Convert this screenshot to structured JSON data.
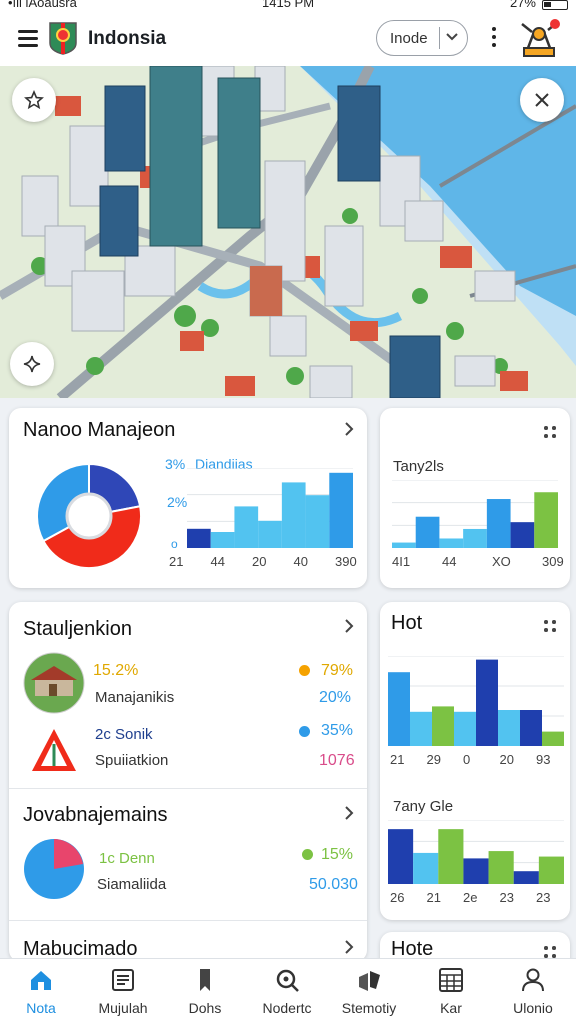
{
  "status_bar": {
    "carrier": "•ıll lAoausra",
    "time": "1415 PM",
    "battery": "27%"
  },
  "header": {
    "title": "Indonsia",
    "mode_label": "Inode",
    "icons": [
      "menu-icon",
      "flag-logo",
      "chevron-down-icon",
      "more-vert-icon",
      "builder-icon"
    ]
  },
  "map": {
    "buttons": [
      "favorite-star-icon",
      "close-icon",
      "sparkle-icon"
    ]
  },
  "cards": {
    "nanoo": {
      "title": "Nanoo Manajeon",
      "legend_pct_1": "3%",
      "legend_name": "Diandiias",
      "legend_pct_2": "2%",
      "axis_zero": "o",
      "ticks": [
        "21",
        "44",
        "20",
        "40",
        "390"
      ]
    },
    "tany": {
      "label": "Tany2ls",
      "ticks": [
        "4I1",
        "44",
        "XO",
        "309"
      ]
    },
    "stauljenkion": {
      "title": "Stauljenkion",
      "rows": [
        {
          "left_value": "15.2%",
          "left_name": "Manajanikis",
          "right_value": "79%",
          "right_name": "20%"
        },
        {
          "left_value": "2c Sonik",
          "left_name": "Spuiiatkion",
          "right_value": "35%",
          "right_name": "1076"
        }
      ]
    },
    "hot": {
      "title": "Hot",
      "ticks": [
        "21",
        "29",
        "0",
        "20",
        "93"
      ]
    },
    "jovab": {
      "title": "Jovabnajemains",
      "value_1": "1c Denn",
      "label_1": "Siamaliida",
      "pct": "15%",
      "value_2": "50.030"
    },
    "tanygle": {
      "label": "7any Gle",
      "ticks": [
        "26",
        "21",
        "2e",
        "23",
        "23"
      ]
    },
    "mabucimado": {
      "title": "Mabucimado"
    },
    "hote": {
      "title": "Hote"
    }
  },
  "nav": {
    "items": [
      {
        "label": "Nota",
        "icon": "home-icon",
        "active": true
      },
      {
        "label": "Mujulah",
        "icon": "document-icon",
        "active": false
      },
      {
        "label": "Dohs",
        "icon": "bookmark-icon",
        "active": false
      },
      {
        "label": "Nodertc",
        "icon": "search-location-icon",
        "active": false
      },
      {
        "label": "Stemotiy",
        "icon": "cubes-icon",
        "active": false
      },
      {
        "label": "Kar",
        "icon": "grid-calendar-icon",
        "active": false
      },
      {
        "label": "Ulonio",
        "icon": "person-icon",
        "active": false
      }
    ]
  },
  "colors": {
    "accent": "#1e8fe0",
    "navy": "#1f3fae",
    "blue": "#2f9be8",
    "light_blue": "#52c3f0",
    "green": "#7cc243",
    "red": "#f02b1a",
    "orange": "#f5a200",
    "yellow_text": "#e0a800"
  },
  "chart_data": [
    {
      "type": "pie",
      "title": "",
      "values": [
        22,
        45,
        33
      ],
      "colors": [
        "#2f47b7",
        "#f02b1a",
        "#2f9be8"
      ]
    },
    {
      "type": "bar",
      "title": "",
      "categories": [
        "21",
        "44",
        "20",
        "40",
        "390"
      ],
      "values": [
        1.2,
        1.0,
        2.6,
        1.7,
        4.1,
        3.3,
        4.7
      ],
      "ylim": [
        0,
        5
      ]
    },
    {
      "type": "bar",
      "title": "",
      "categories": [
        "4I1",
        "44",
        "XO",
        "309"
      ],
      "values": [
        0.4,
        2.3,
        0.7,
        1.4,
        3.6,
        1.9,
        4.1
      ],
      "ylim": [
        0,
        5
      ]
    },
    {
      "type": "bar",
      "title": "",
      "categories": [
        "21",
        "29",
        "0",
        "20",
        "93"
      ],
      "values": [
        4.1,
        1.9,
        2.2,
        1.9,
        4.8,
        2.0,
        2.0,
        0.8
      ],
      "ylim": [
        0,
        5
      ]
    },
    {
      "type": "bar",
      "title": "",
      "categories": [
        "26",
        "21",
        "2e",
        "23",
        "23"
      ],
      "values": [
        3.0,
        1.7,
        3.0,
        1.4,
        1.8,
        0.7,
        1.5
      ],
      "ylim": [
        0,
        3.5
      ]
    }
  ]
}
